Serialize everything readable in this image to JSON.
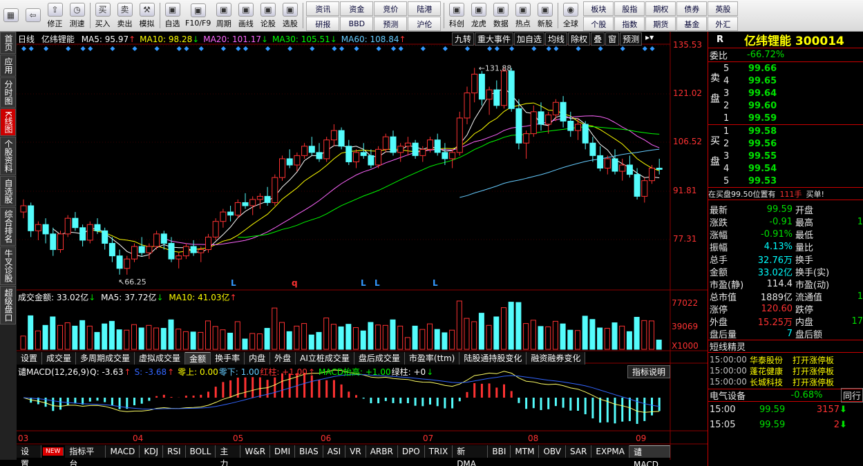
{
  "toolbar": {
    "group1": [
      {
        "label": "",
        "icon": "windows-icon"
      },
      {
        "label": "",
        "icon": "back-arrow-icon"
      },
      {
        "label": "修正",
        "icon": "up-arrow-icon"
      },
      {
        "label": "测速",
        "icon": "clock-icon"
      }
    ],
    "group2": [
      {
        "label": "买入",
        "icon": "buy-icon"
      },
      {
        "label": "卖出",
        "icon": "sell-icon"
      },
      {
        "label": "模拟",
        "icon": "hammer-icon"
      }
    ],
    "group3": [
      {
        "label": "自选"
      },
      {
        "label": "F10/F9"
      },
      {
        "label": "周期"
      },
      {
        "label": "画线"
      },
      {
        "label": "论股"
      },
      {
        "label": "选股"
      }
    ],
    "grid1": [
      "资讯",
      "资金",
      "竞价",
      "陆港",
      "研报",
      "BBD",
      "预测",
      "沪伦"
    ],
    "group4": [
      {
        "label": "科创"
      },
      {
        "label": "龙虎"
      },
      {
        "label": "数据"
      },
      {
        "label": "热点"
      },
      {
        "label": "新股"
      }
    ],
    "global_label": "全球",
    "grid2": [
      "板块",
      "股指",
      "期权",
      "债券",
      "英股",
      "个股",
      "指数",
      "期货",
      "基金",
      "外汇"
    ]
  },
  "vtabs": [
    "首页",
    "应用",
    "分时图",
    "K线图",
    "个股资料",
    "自选股",
    "综合排名",
    "牛叉诊股",
    "超级盘口"
  ],
  "chart": {
    "period": "日线",
    "stock_name": "亿纬锂能",
    "ma": [
      {
        "label": "MA5: 95.97",
        "arrow": "↑",
        "color": "#ffffff"
      },
      {
        "label": "MA10: 98.28",
        "arrow": "↓",
        "color": "#ffff00"
      },
      {
        "label": "MA20: 101.17",
        "arrow": "↓",
        "color": "#ff66ff"
      },
      {
        "label": "MA30: 105.51",
        "arrow": "↓",
        "color": "#00ff00"
      },
      {
        "label": "MA60: 108.84",
        "arrow": "↑",
        "color": "#66ccff"
      }
    ],
    "top_buttons": [
      "九转",
      "重大事件",
      "加自选",
      "均线",
      "除权",
      "叠",
      "窗",
      "预测"
    ],
    "price_ticks": [
      "135.53",
      "121.02",
      "106.52",
      "91.81",
      "77.31"
    ],
    "high_label": "131.88",
    "low_label": "66.25",
    "markers": [
      "L",
      "q",
      "L",
      "L",
      "L"
    ],
    "vol_header": {
      "amount": "成交金额: 33.02亿",
      "amount_arrow": "↓",
      "ma5": "MA5: 37.72亿",
      "ma5_arrow": "↓",
      "ma10": "MA10: 41.03亿",
      "ma10_arrow": "↑"
    },
    "vol_ticks": [
      "77022",
      "39069",
      "X1000"
    ],
    "mid_tabs": [
      "设置",
      "成交量",
      "多周期成交量",
      "虚拟成交量",
      "金额",
      "换手率",
      "内盘",
      "外盘",
      "AI立桩成交量",
      "盘后成交量",
      "市盈率(ttm)",
      "陆股通持股变化",
      "融资融券变化"
    ],
    "mid_selected": "金额",
    "macd_header": [
      {
        "t": "谴MACD(12,26,9)",
        "c": "#ffffff"
      },
      {
        "t": "Q: -3.63",
        "c": "#ffffff"
      },
      {
        "t": "↑",
        "c": "#ff3232"
      },
      {
        "t": "S: -3.68",
        "c": "#3366ff"
      },
      {
        "t": "↑",
        "c": "#ff3232"
      },
      {
        "t": "零上: 0.00",
        "c": "#ffff00"
      },
      {
        "t": "零下: 1.00",
        "c": "#66ccff"
      },
      {
        "t": "红柱: +1.00",
        "c": "#ff3232"
      },
      {
        "t": "↑",
        "c": "#ff3232"
      },
      {
        "t": "MACD抬高: +1.00",
        "c": "#00ff00"
      },
      {
        "t": "绿柱: +0",
        "c": "#ffffff"
      },
      {
        "t": "↓",
        "c": "#00e000"
      }
    ],
    "indicator_help": "指标说明",
    "months": [
      "03",
      "04",
      "05",
      "06",
      "07",
      "08",
      "09"
    ],
    "bottom_tabs": [
      "设置",
      "NEW",
      "指标平台",
      "MACD",
      "KDJ",
      "RSI",
      "BOLL",
      "主力",
      "W&R",
      "DMI",
      "BIAS",
      "ASI",
      "VR",
      "ARBR",
      "DPO",
      "TRIX",
      "新DMA",
      "BBI",
      "MTM",
      "OBV",
      "SAR",
      "EXPMA",
      "谴MACD"
    ],
    "bottom_selected": "谴MACD"
  },
  "right": {
    "r_label": "R",
    "title": "亿纬锂能 300014",
    "weibi_label": "委比",
    "weibi": "-66.72%",
    "sell_label": "卖盘",
    "buy_label": "买盘",
    "sell": [
      {
        "n": "5",
        "p": "99.66"
      },
      {
        "n": "4",
        "p": "99.65"
      },
      {
        "n": "3",
        "p": "99.64"
      },
      {
        "n": "2",
        "p": "99.60"
      },
      {
        "n": "1",
        "p": "99.59"
      }
    ],
    "buy": [
      {
        "n": "1",
        "p": "99.58"
      },
      {
        "n": "2",
        "p": "99.56"
      },
      {
        "n": "3",
        "p": "99.55"
      },
      {
        "n": "4",
        "p": "99.54"
      },
      {
        "n": "5",
        "p": "99.53"
      }
    ],
    "notice": {
      "prefix": "在买盘99.50位置有",
      "qty": "111手",
      "suffix": "买单!"
    },
    "stats": [
      {
        "l": "最新",
        "v": "99.59",
        "vc": "grn",
        "l2": "开盘"
      },
      {
        "l": "涨跌",
        "v": "-0.91",
        "vc": "grn",
        "l2": "最高"
      },
      {
        "l": "涨幅",
        "v": "-0.91%",
        "vc": "grn",
        "l2": "最低"
      },
      {
        "l": "振幅",
        "v": "4.13%",
        "vc": "cyan",
        "l2": "量比"
      },
      {
        "l": "总手",
        "v": "32.76万",
        "vc": "cyan",
        "l2": "换手"
      },
      {
        "l": "金额",
        "v": "33.02亿",
        "vc": "cyan",
        "l2": "换手(实)"
      },
      {
        "l": "市盈(静)",
        "v": "114.4",
        "vc": "wht",
        "l2": "市盈(动)"
      },
      {
        "l": "总市值",
        "v": "1889亿",
        "vc": "wht",
        "l2": "流通值"
      },
      {
        "l": "涨停",
        "v": "120.60",
        "vc": "red",
        "l2": "跌停"
      },
      {
        "l": "外盘",
        "v": "15.25万",
        "vc": "red",
        "l2": "内盘"
      },
      {
        "l": "盘后量",
        "v": "7",
        "vc": "cyan",
        "l2": "盘后额"
      }
    ],
    "stat_extra": {
      "r2": "1",
      "r8": "1",
      "r10": "17"
    },
    "news_title": "短线精灵",
    "news": [
      {
        "t": "15:00:00",
        "s": "华泰股份",
        "e": "打开涨停板"
      },
      {
        "t": "15:00:00",
        "s": "蓬花健康",
        "e": "打开涨停板"
      },
      {
        "t": "15:00:00",
        "s": "长城科技",
        "e": "打开涨停板"
      }
    ],
    "sector": {
      "name": "电气设备",
      "chg": "-0.68%",
      "btn": "同行"
    },
    "ticks": [
      {
        "t": "15:00",
        "p": "99.59",
        "v": "3157"
      },
      {
        "t": "15:05",
        "p": "99.59",
        "v": "2"
      }
    ]
  },
  "chart_data": {
    "type": "candlestick",
    "price_range": [
      62,
      140
    ],
    "x": [
      "03",
      "04",
      "05",
      "06",
      "07",
      "08",
      "09"
    ],
    "candles": [
      [
        86,
        90,
        84,
        88
      ],
      [
        88,
        89,
        78,
        80
      ],
      [
        80,
        83,
        77,
        82
      ],
      [
        82,
        84,
        76,
        79
      ],
      [
        79,
        81,
        72,
        74
      ],
      [
        74,
        80,
        73,
        79
      ],
      [
        79,
        85,
        78,
        84
      ],
      [
        84,
        86,
        80,
        81
      ],
      [
        81,
        82,
        75,
        77
      ],
      [
        77,
        83,
        76,
        82
      ],
      [
        82,
        84,
        79,
        80
      ],
      [
        80,
        81,
        74,
        76
      ],
      [
        76,
        78,
        70,
        72
      ],
      [
        72,
        74,
        66,
        68
      ],
      [
        68,
        72,
        66,
        71
      ],
      [
        71,
        76,
        70,
        75
      ],
      [
        75,
        78,
        72,
        73
      ],
      [
        73,
        76,
        71,
        75
      ],
      [
        75,
        80,
        74,
        79
      ],
      [
        79,
        80,
        74,
        76
      ],
      [
        76,
        78,
        70,
        71
      ],
      [
        71,
        73,
        68,
        72
      ],
      [
        72,
        76,
        71,
        75
      ],
      [
        75,
        77,
        72,
        73
      ],
      [
        73,
        75,
        70,
        74
      ],
      [
        74,
        79,
        73,
        78
      ],
      [
        78,
        84,
        77,
        83
      ],
      [
        83,
        87,
        81,
        86
      ],
      [
        86,
        88,
        83,
        85
      ],
      [
        85,
        90,
        84,
        89
      ],
      [
        89,
        92,
        87,
        88
      ],
      [
        88,
        91,
        85,
        90
      ],
      [
        90,
        92,
        87,
        91
      ],
      [
        91,
        94,
        88,
        89
      ],
      [
        89,
        98,
        88,
        97
      ],
      [
        97,
        104,
        96,
        103
      ],
      [
        103,
        106,
        100,
        101
      ],
      [
        101,
        105,
        99,
        104
      ],
      [
        104,
        108,
        103,
        107
      ],
      [
        107,
        110,
        104,
        105
      ],
      [
        105,
        108,
        102,
        103
      ],
      [
        103,
        110,
        102,
        109
      ],
      [
        109,
        114,
        107,
        112
      ],
      [
        112,
        113,
        106,
        107
      ],
      [
        107,
        109,
        101,
        102
      ],
      [
        102,
        106,
        100,
        105
      ],
      [
        105,
        108,
        103,
        104
      ],
      [
        104,
        106,
        100,
        101
      ],
      [
        101,
        107,
        100,
        106
      ],
      [
        106,
        111,
        105,
        110
      ],
      [
        110,
        112,
        104,
        105
      ],
      [
        105,
        108,
        102,
        107
      ],
      [
        107,
        110,
        104,
        108
      ],
      [
        108,
        109,
        103,
        104
      ],
      [
        104,
        107,
        102,
        106
      ],
      [
        106,
        110,
        105,
        109
      ],
      [
        109,
        111,
        104,
        105
      ],
      [
        105,
        108,
        101,
        103
      ],
      [
        103,
        106,
        100,
        105
      ],
      [
        105,
        118,
        104,
        116
      ],
      [
        116,
        126,
        114,
        124
      ],
      [
        124,
        132,
        121,
        130
      ],
      [
        130,
        131,
        120,
        122
      ],
      [
        122,
        126,
        117,
        125
      ],
      [
        125,
        128,
        119,
        120
      ],
      [
        120,
        132,
        119,
        131
      ],
      [
        131,
        132,
        118,
        119
      ],
      [
        119,
        122,
        106,
        108
      ],
      [
        108,
        112,
        103,
        111
      ],
      [
        111,
        120,
        110,
        118
      ],
      [
        118,
        121,
        112,
        114
      ],
      [
        114,
        118,
        111,
        117
      ],
      [
        117,
        122,
        115,
        121
      ],
      [
        121,
        123,
        113,
        115
      ],
      [
        115,
        118,
        110,
        112
      ],
      [
        112,
        116,
        109,
        114
      ],
      [
        114,
        115,
        106,
        108
      ],
      [
        108,
        110,
        102,
        104
      ],
      [
        104,
        107,
        99,
        100
      ],
      [
        100,
        104,
        98,
        103
      ],
      [
        103,
        106,
        98,
        99
      ],
      [
        99,
        103,
        96,
        101
      ],
      [
        101,
        104,
        97,
        98
      ],
      [
        98,
        100,
        90,
        91
      ],
      [
        91,
        97,
        89,
        96
      ],
      [
        96,
        101,
        95,
        100
      ],
      [
        100,
        103,
        98,
        99.59
      ]
    ]
  }
}
